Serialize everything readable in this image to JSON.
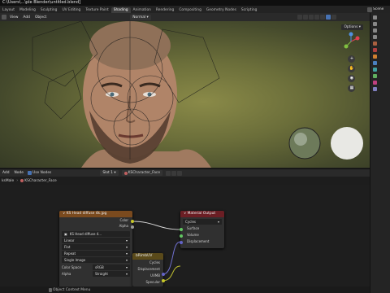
{
  "window": {
    "title": "C:\\Users\\...\\ple Blender\\untitled.blend]"
  },
  "workspace_tabs": [
    {
      "label": "Layout"
    },
    {
      "label": "Modeling"
    },
    {
      "label": "Sculpting"
    },
    {
      "label": "UV Editing"
    },
    {
      "label": "Texture Paint"
    },
    {
      "label": "Shading",
      "active": true
    },
    {
      "label": "Animation"
    },
    {
      "label": "Rendering"
    },
    {
      "label": "Compositing"
    },
    {
      "label": "Geometry Nodes"
    },
    {
      "label": "Scripting"
    }
  ],
  "scene": {
    "label": "Scene"
  },
  "viewport_header": {
    "menus": [
      "View",
      "Add",
      "Object"
    ],
    "orientation": "Normal",
    "options_label": "Options"
  },
  "node_header": {
    "menus": [
      "Add",
      "Node"
    ],
    "use_nodes_label": "Use Nodes",
    "slot_label": "Slot 1",
    "material_name": "KSCharacter_Face"
  },
  "breadcrumbs": {
    "object": "ksMale",
    "material": "KSCharacter_Face"
  },
  "image_node": {
    "title": "KS Head diffuse 4k.jpg",
    "outputs": [
      "Color",
      "Alpha"
    ],
    "image_name": "KS Head diffuse 4...",
    "interpolation": "Linear",
    "projection": "Flat",
    "extension": "Repeat",
    "source": "Single Image",
    "color_space_label": "Color Space",
    "color_space_value": "sRGB",
    "alpha_label": "Alpha",
    "alpha_value": "Straight"
  },
  "output_node": {
    "title": "Material Output",
    "target": "Cycles",
    "inputs": [
      "Surface",
      "Volume",
      "Displacement"
    ]
  },
  "middle_node": {
    "title": "bRimbUV",
    "rows": [
      "Cycles",
      "Displacement",
      "UVMB",
      "Specular"
    ]
  },
  "status": {
    "hint": "Object Context Menu"
  },
  "colors": {
    "image_header": "#7a4a1e",
    "output_header": "#6b1e24",
    "mid_header": "#5a4a1a",
    "active_tab": "#3d3d3d",
    "selected": "#4772b3"
  }
}
